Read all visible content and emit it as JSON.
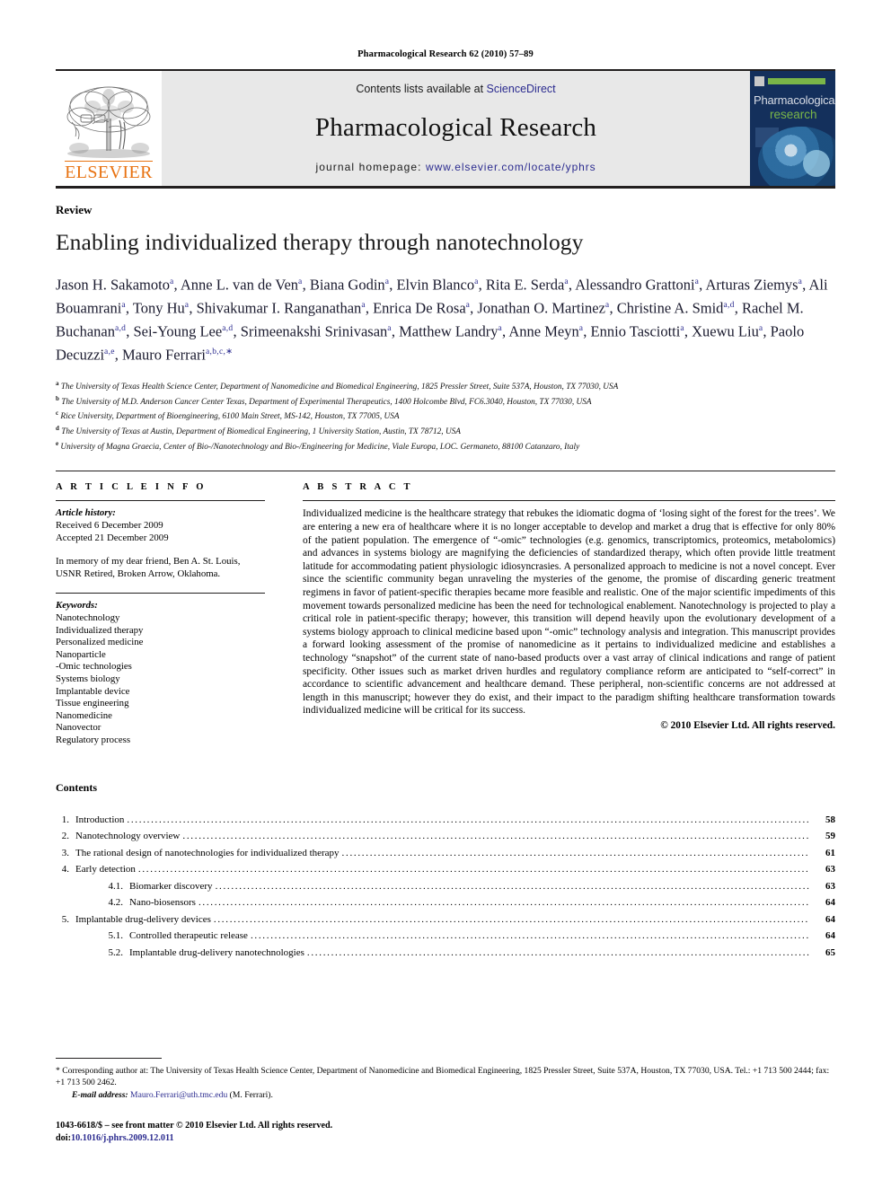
{
  "running_head": "Pharmacological Research 62 (2010) 57–89",
  "masthead": {
    "publisher_name": "ELSEVIER",
    "contents_prefix": "Contents lists available at ",
    "sciencedirect_link": "ScienceDirect",
    "journal_title": "Pharmacological Research",
    "homepage_prefix": "journal homepage: ",
    "homepage_url": "www.elsevier.com/locate/yphrs",
    "cover": {
      "title_line1": "Pharmacological",
      "title_line2": "research"
    }
  },
  "article": {
    "doctype": "Review",
    "title": "Enabling individualized therapy through nanotechnology",
    "authors": [
      {
        "name": "Jason H. Sakamoto",
        "sup": "a",
        "sep": ","
      },
      {
        "name": "Anne L. van de Ven",
        "sup": "a",
        "sep": ","
      },
      {
        "name": "Biana Godin",
        "sup": "a",
        "sep": ","
      },
      {
        "name": "Elvin Blanco",
        "sup": "a",
        "sep": ","
      },
      {
        "name": "Rita E. Serda",
        "sup": "a",
        "sep": ","
      },
      {
        "name": "Alessandro Grattoni",
        "sup": "a",
        "sep": ","
      },
      {
        "name": "Arturas Ziemys",
        "sup": "a",
        "sep": ","
      },
      {
        "name": "Ali Bouamrani",
        "sup": "a",
        "sep": ","
      },
      {
        "name": "Tony Hu",
        "sup": "a",
        "sep": ","
      },
      {
        "name": "Shivakumar I. Ranganathan",
        "sup": "a",
        "sep": ","
      },
      {
        "name": "Enrica De Rosa",
        "sup": "a",
        "sep": ","
      },
      {
        "name": "Jonathan O. Martinez",
        "sup": "a",
        "sep": ","
      },
      {
        "name": "Christine A. Smid",
        "sup": "a,d",
        "sep": ","
      },
      {
        "name": "Rachel M. Buchanan",
        "sup": "a,d",
        "sep": ","
      },
      {
        "name": "Sei-Young Lee",
        "sup": "a,d",
        "sep": ","
      },
      {
        "name": "Srimeenakshi Srinivasan",
        "sup": "a",
        "sep": ","
      },
      {
        "name": "Matthew Landry",
        "sup": "a",
        "sep": ","
      },
      {
        "name": "Anne Meyn",
        "sup": "a",
        "sep": ","
      },
      {
        "name": "Ennio Tasciotti",
        "sup": "a",
        "sep": ","
      },
      {
        "name": "Xuewu Liu",
        "sup": "a",
        "sep": ","
      },
      {
        "name": "Paolo Decuzzi",
        "sup": "a,e",
        "sep": ","
      },
      {
        "name": "Mauro Ferrari",
        "sup": "a,b,c,∗",
        "sep": ""
      }
    ],
    "affiliations": [
      {
        "mark": "a",
        "text": "The University of Texas Health Science Center, Department of Nanomedicine and Biomedical Engineering, 1825 Pressler Street, Suite 537A, Houston, TX 77030, USA"
      },
      {
        "mark": "b",
        "text": "The University of M.D. Anderson Cancer Center Texas, Department of Experimental Therapeutics, 1400 Holcombe Blvd, FC6.3040, Houston, TX 77030, USA"
      },
      {
        "mark": "c",
        "text": "Rice University, Department of Bioengineering, 6100 Main Street, MS-142, Houston, TX 77005, USA"
      },
      {
        "mark": "d",
        "text": "The University of Texas at Austin, Department of Biomedical Engineering, 1 University Station, Austin, TX 78712, USA"
      },
      {
        "mark": "e",
        "text": "University of Magna Graecia, Center of Bio-/Nanotechnology and Bio-/Engineering for Medicine, Viale Europa, LOC. Germaneto, 88100 Catanzaro, Italy"
      }
    ]
  },
  "article_info": {
    "heading": "A R T I C L E   I N F O",
    "history_label": "Article history:",
    "received": "Received 6 December 2009",
    "accepted": "Accepted 21 December 2009",
    "dedication": "In memory of my dear friend, Ben A. St. Louis, USNR Retired, Broken Arrow, Oklahoma.",
    "keywords_label": "Keywords:",
    "keywords": [
      "Nanotechnology",
      "Individualized therapy",
      "Personalized medicine",
      "Nanoparticle",
      "-Omic technologies",
      "Systems biology",
      "Implantable device",
      "Tissue engineering",
      "Nanomedicine",
      "Nanovector",
      "Regulatory process"
    ]
  },
  "abstract": {
    "heading": "A B S T R A C T",
    "text": "Individualized medicine is the healthcare strategy that rebukes the idiomatic dogma of ‘losing sight of the forest for the trees’. We are entering a new era of healthcare where it is no longer acceptable to develop and market a drug that is effective for only 80% of the patient population. The emergence of “-omic” technologies (e.g. genomics, transcriptomics, proteomics, metabolomics) and advances in systems biology are magnifying the deficiencies of standardized therapy, which often provide little treatment latitude for accommodating patient physiologic idiosyncrasies. A personalized approach to medicine is not a novel concept. Ever since the scientific community began unraveling the mysteries of the genome, the promise of discarding generic treatment regimens in favor of patient-specific therapies became more feasible and realistic. One of the major scientific impediments of this movement towards personalized medicine has been the need for technological enablement. Nanotechnology is projected to play a critical role in patient-specific therapy; however, this transition will depend heavily upon the evolutionary development of a systems biology approach to clinical medicine based upon “-omic” technology analysis and integration. This manuscript provides a forward looking assessment of the promise of nanomedicine as it pertains to individualized medicine and establishes a technology “snapshot” of the current state of nano-based products over a vast array of clinical indications and range of patient specificity. Other issues such as market driven hurdles and regulatory compliance reform are anticipated to “self-correct” in accordance to scientific advancement and healthcare demand. These peripheral, non-scientific concerns are not addressed at length in this manuscript; however they do exist, and their impact to the paradigm shifting healthcare transformation towards individualized medicine will be critical for its success.",
    "copyright": "© 2010 Elsevier Ltd. All rights reserved."
  },
  "contents": {
    "heading": "Contents",
    "entries": [
      {
        "num": "1.",
        "label": "Introduction",
        "page": "58",
        "sub": false
      },
      {
        "num": "2.",
        "label": "Nanotechnology overview",
        "page": "59",
        "sub": false
      },
      {
        "num": "3.",
        "label": "The rational design of nanotechnologies for individualized therapy ",
        "page": "61",
        "sub": false
      },
      {
        "num": "4.",
        "label": "Early detection",
        "page": "63",
        "sub": false
      },
      {
        "num": "4.1.",
        "label": "Biomarker discovery",
        "page": "63",
        "sub": true
      },
      {
        "num": "4.2.",
        "label": "Nano-biosensors",
        "page": "64",
        "sub": true
      },
      {
        "num": "5.",
        "label": "Implantable drug-delivery devices ",
        "page": "64",
        "sub": false
      },
      {
        "num": "5.1.",
        "label": "Controlled therapeutic release ",
        "page": "64",
        "sub": true
      },
      {
        "num": "5.2.",
        "label": "Implantable drug-delivery nanotechnologies ",
        "page": "65",
        "sub": true
      }
    ]
  },
  "footnotes": {
    "corresponding": "* Corresponding author at: The University of Texas Health Science Center, Department of Nanomedicine and Biomedical Engineering, 1825 Pressler Street, Suite 537A, Houston, TX 77030, USA. Tel.: +1 713 500 2444; fax: +1 713 500 2462.",
    "email_label": "E-mail address:",
    "email": "Mauro.Ferrari@uth.tmc.edu",
    "email_owner": "(M. Ferrari).",
    "issn_line": "1043-6618/$ – see front matter © 2010 Elsevier Ltd. All rights reserved.",
    "doi_prefix": "doi:",
    "doi": "10.1016/j.phrs.2009.12.011"
  },
  "colors": {
    "elsevier_orange": "#e87211",
    "link_blue": "#2b2b8f",
    "masthead_grey": "#e8e8e8",
    "cover_navy": "#14305c",
    "cover_green": "#7ab648"
  }
}
